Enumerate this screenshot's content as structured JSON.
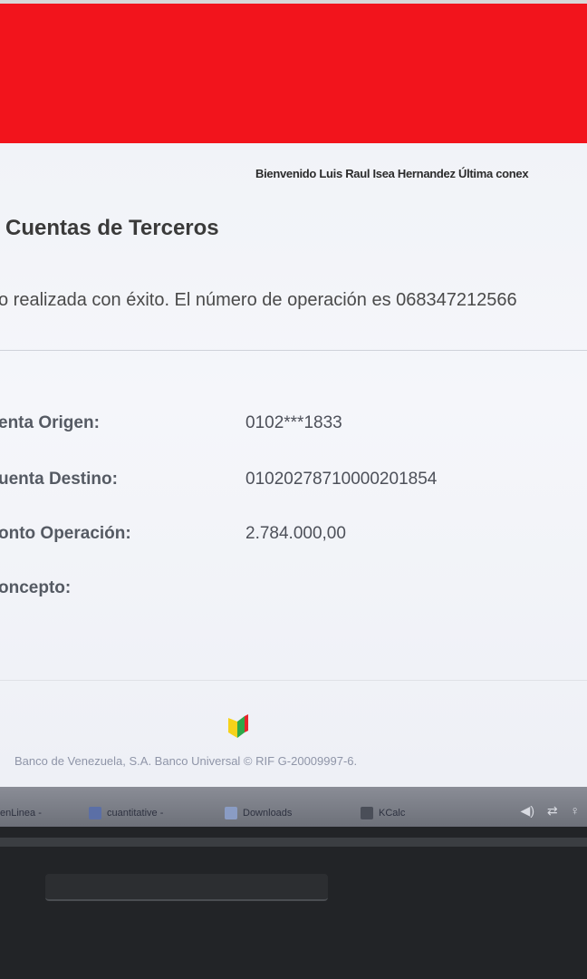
{
  "colors": {
    "brand_red": "#f2141c",
    "page_bg": "#f3f5f9",
    "label_text": "#555a63"
  },
  "header": {
    "welcome_text": "Bienvenido Luis Raul  Isea Hernandez  Última conex"
  },
  "page": {
    "title": "Cuentas de Terceros",
    "success_message": "o realizada con éxito. El número de operación es 068347212566"
  },
  "details": [
    {
      "label": "enta Origen:",
      "value": "0102***1833"
    },
    {
      "label": "uenta Destino:",
      "value": "01020278710000201854"
    },
    {
      "label": "onto Operación:",
      "value": "2.784.000,00"
    },
    {
      "label": "oncepto:",
      "value": ""
    }
  ],
  "footer": {
    "logo_icon": "bank-logo-icon",
    "copyright": "Banco de Venezuela, S.A. Banco Universal © RIF G-20009997-6."
  },
  "taskbar": {
    "tasks": [
      {
        "label": "enLinea -",
        "icon": "browser-icon"
      },
      {
        "label": "cuantitative -",
        "icon": "folder-icon"
      },
      {
        "label": "Downloads",
        "icon": "folder-icon"
      },
      {
        "label": "KCalc",
        "icon": "calculator-icon"
      }
    ],
    "tray_icons": [
      "volume-icon",
      "network-icon",
      "clock-icon"
    ]
  }
}
